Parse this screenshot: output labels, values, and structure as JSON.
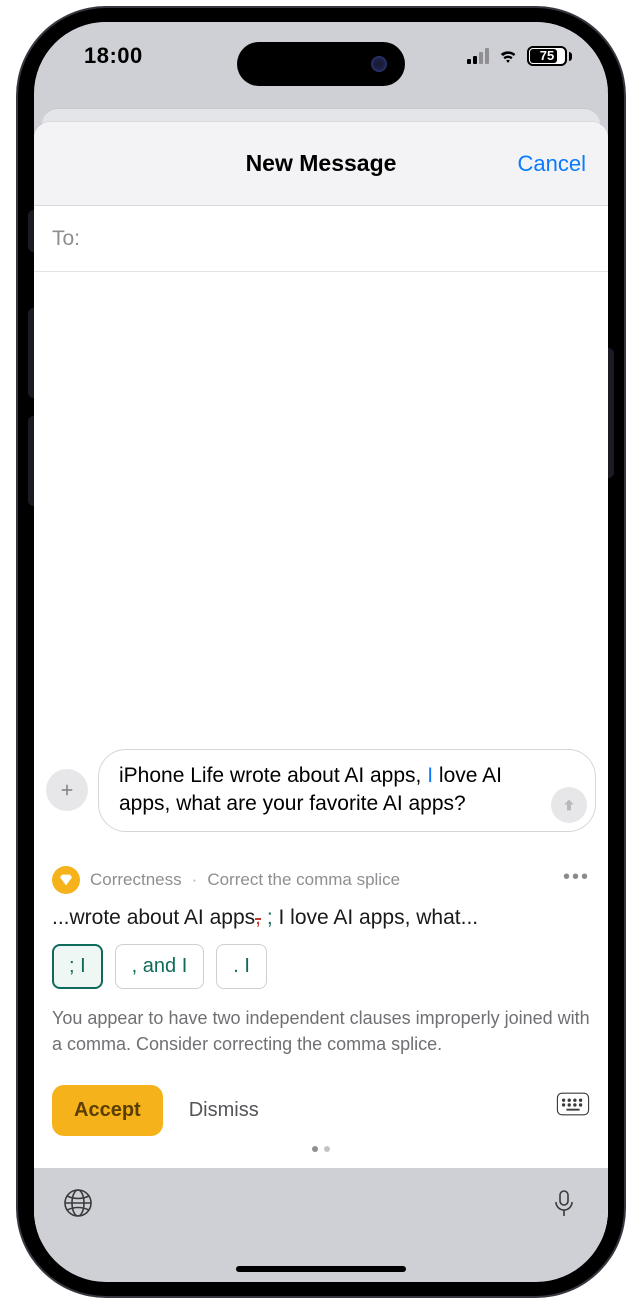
{
  "status": {
    "time": "18:00",
    "battery_pct": "75"
  },
  "sheet": {
    "title": "New Message",
    "cancel": "Cancel",
    "to_label": "To:"
  },
  "compose": {
    "text_before_cursor": "iPhone Life wrote about AI apps, ",
    "text_cursor_char": "I",
    "text_after_cursor": " love AI apps, what are your favorite AI apps?"
  },
  "grammarly": {
    "category": "Correctness",
    "title": "Correct the comma splice",
    "sentence_lead": "...wrote about AI apps",
    "sentence_strike": ",",
    "sentence_insert": " ; ",
    "sentence_tail": "I love AI apps, what...",
    "chips": [
      "; I",
      ", and I",
      ". I"
    ],
    "explanation": "You appear to have two independent clauses improperly joined with a comma. Consider correcting the comma splice.",
    "accept": "Accept",
    "dismiss": "Dismiss"
  }
}
